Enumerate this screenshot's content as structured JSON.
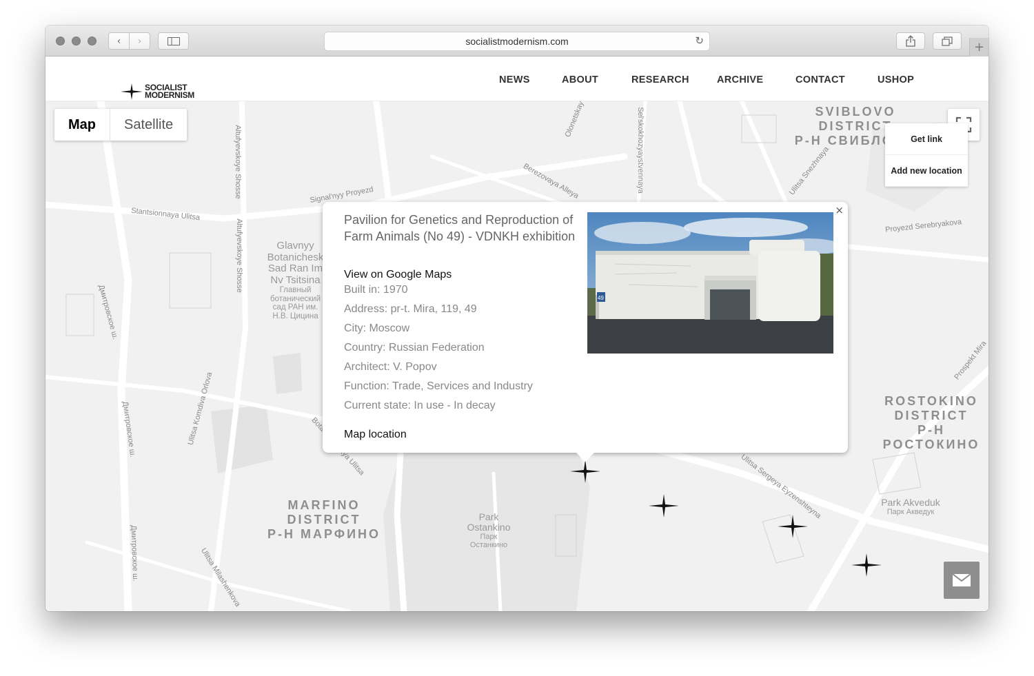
{
  "browser": {
    "url": "socialistmodernism.com",
    "icons": [
      "back-icon",
      "forward-icon",
      "sidebar-icon",
      "reload-icon",
      "share-icon",
      "tabs-icon",
      "new-tab-icon"
    ]
  },
  "site": {
    "logo_line1": "SOCIALIST",
    "logo_line2": "MODERNISM",
    "nav": [
      "NEWS",
      "ABOUT",
      "RESEARCH",
      "ARCHIVE",
      "CONTACT",
      "USHOP"
    ]
  },
  "map": {
    "toggle": {
      "map": "Map",
      "satellite": "Satellite"
    },
    "menu": {
      "get_link": "Get link",
      "add_location": "Add new location"
    },
    "districts": {
      "sviblovo": {
        "line1": "SVIBLOVO",
        "line2": "DISTRICT",
        "line3": "Р-Н СВИБЛОВО"
      },
      "rostokino": {
        "line1": "ROSTOKINO",
        "line2": "DISTRICT",
        "line3": "Р-Н РОСТОКИНО"
      },
      "marfino": {
        "line1": "MARFINO",
        "line2": "DISTRICT",
        "line3": "Р-Н МАРФИНО"
      }
    },
    "places": {
      "park_ostankino": {
        "line1": "Park",
        "line2": "Ostankino",
        "line3": "Парк",
        "line4": "Останкино"
      },
      "park_akveduk": {
        "line1": "Park Akveduk",
        "line2": "Парк Акведук"
      },
      "botanical": {
        "line1": "Glavnyy",
        "line2": "Botanichesk",
        "line3": "Sad Ran Im",
        "line4": "Nv Tsitsina",
        "line5": "Главный",
        "line6": "ботанический",
        "line7": "сад РАН им.",
        "line8": "Н.В. Цицина"
      }
    },
    "streets": {
      "s1": "Stantsionnaya Ulitsa",
      "s2": "Altufyevskoye Shosse",
      "s3": "Altufyevskoye Shosse",
      "s4": "Signal'nyy Proyezd",
      "s5": "Berezovaya Alleya",
      "s6": "Olonetskay",
      "s7": "Sel'skokhozyaystvennaya",
      "s8": "Ulitsa Snezhnaya",
      "s9": "Proyezd Serebryakova",
      "s10": "Дмитровское ш.",
      "s11": "Дмитровское ш.",
      "s12": "Дмитровское ш.",
      "s13": "Ulitsa Komdiva Orlova",
      "s14": "Botanicheskaya Ulitsa",
      "s15": "Ulitsa Sergeya Eyzenshteyna",
      "s16": "Ulitsa Milashenkova",
      "s17": "Prospekt Mira"
    }
  },
  "popup": {
    "title": "Pavilion for Genetics and Reproduction of Farm Animals (No 49) - VDNKH exhibition",
    "google_link": "View on Google Maps",
    "built": "Built in: 1970",
    "address": "Address: pr-t. Mira, 119, 49",
    "city": "City: Moscow",
    "country": "Country: Russian Federation",
    "architect": "Architect: V. Popov",
    "function": "Function: Trade, Services and Industry",
    "state": "Current state: In use - In decay",
    "map_location": "Map location",
    "close": "×",
    "photo_badge": "49"
  }
}
